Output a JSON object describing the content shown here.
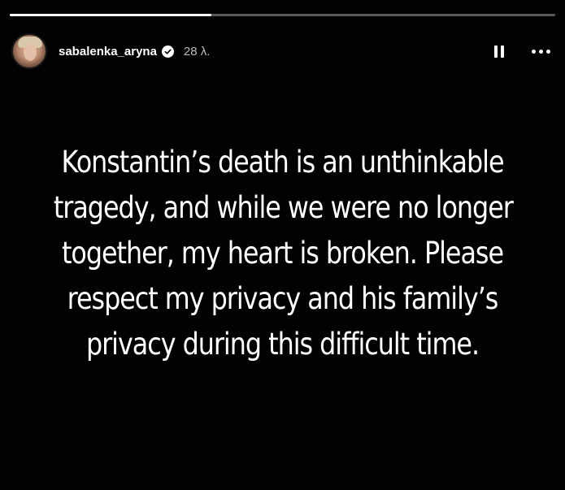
{
  "story": {
    "progress": 0.37,
    "username": "sabalenka_aryna",
    "verified": true,
    "timestamp": "28 λ.",
    "message_lines": [
      "Konstantin’s death is an unthinkable",
      "tragedy, and while we were no longer",
      "together, my heart is broken. Please",
      "respect my privacy and his family’s",
      "privacy during this difficult time."
    ]
  },
  "icons": {
    "pause": "pause-icon",
    "more": "more-options-icon",
    "verified": "verified-badge-icon"
  },
  "colors": {
    "background": "#020202",
    "text": "#ffffff",
    "timestamp": "#bdbdbd",
    "progress_track": "rgba(255,255,255,0.35)"
  }
}
